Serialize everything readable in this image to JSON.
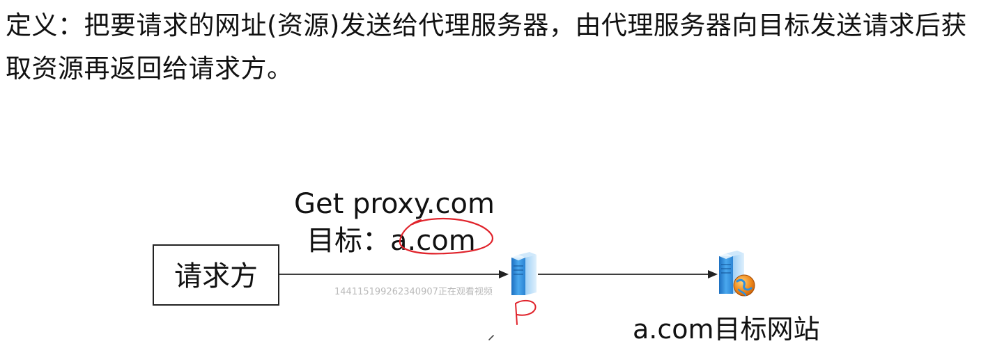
{
  "definition_text": "定义：把要请求的网址(资源)发送给代理服务器，由代理服务器向目标发送请求后获取资源再返回给请求方。",
  "diagram": {
    "client_label": "请求方",
    "request_line1": "Get proxy.com",
    "request_line2": "目标：a.com",
    "target_label": "a.com目标网站",
    "watermark": "1441151992623409​07正在观看视频",
    "annotation_letter": "P"
  },
  "colors": {
    "ink": "#111111",
    "annotation_red": "#e0232b",
    "server_blue": "#2f8fdc",
    "globe_orange": "#f08a1c"
  },
  "icons": [
    "proxy-server-icon",
    "web-server-icon",
    "globe-icon"
  ]
}
